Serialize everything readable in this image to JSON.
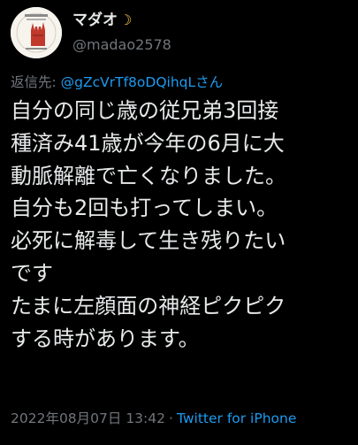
{
  "user": {
    "display_name": "マダオ",
    "handle": "@madao2578",
    "avatar_icon": "rock-hand-logo-avatar",
    "moon_icon": "crescent-moon-emoji"
  },
  "reply": {
    "prefix": "返信先: ",
    "handle": "@gZcVrTf8oDQihqLさん"
  },
  "tweet": {
    "lines": [
      "自分の同じ歳の従兄弟3回接",
      "種済み41歳が今年の6月に大",
      "動脈解離で亡くなりました。",
      "自分も2回も打ってしまい。",
      "必死に解毒して生き残りたい",
      "です",
      "たまに左顔面の神経ピクピク",
      "する時があります。"
    ]
  },
  "meta": {
    "timestamp": "2022年08月07日 13:42",
    "separator": "·",
    "source": "Twitter for iPhone"
  },
  "colors": {
    "background": "#000000",
    "text": "#e7e9ea",
    "muted": "#71767b",
    "link": "#1d9bf0"
  }
}
